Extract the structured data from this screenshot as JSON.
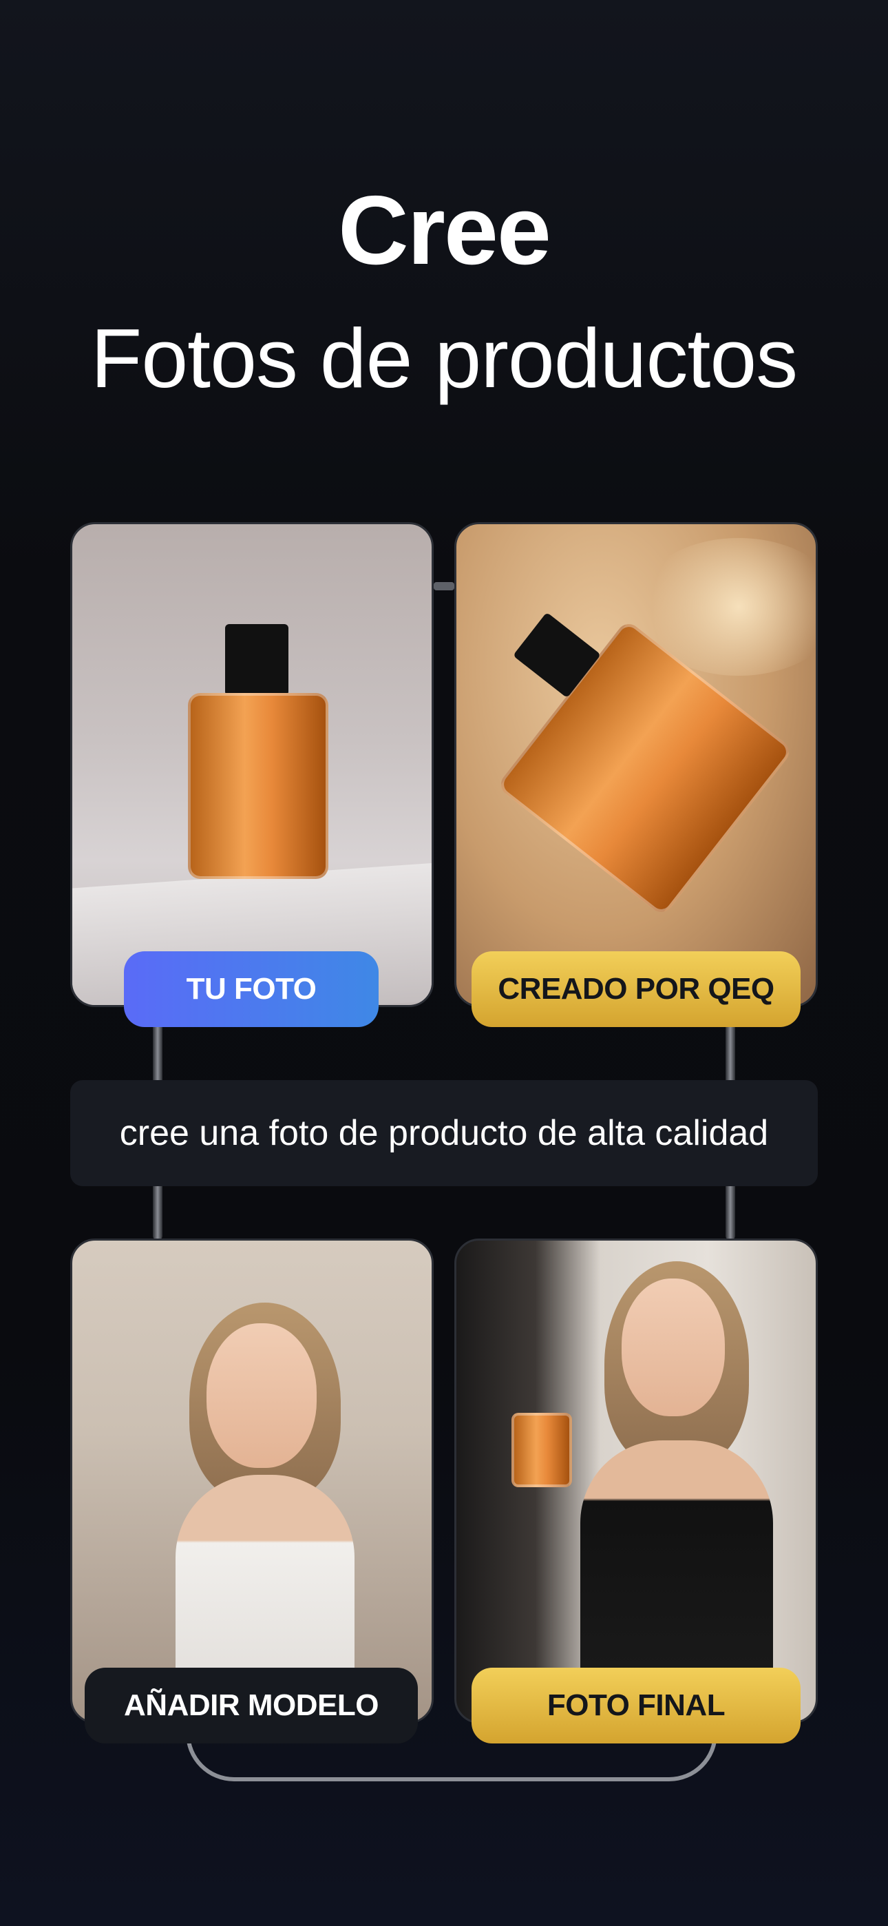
{
  "header": {
    "title": "Cree",
    "subtitle": "Fotos de productos"
  },
  "cards": {
    "your_photo_label": "TU FOTO",
    "created_label": "CREADO POR QEQ",
    "add_model_label": "AÑADIR MODELO",
    "final_photo_label": "FOTO FINAL"
  },
  "prompt": {
    "text": "cree una foto de producto de alta calidad"
  },
  "colors": {
    "accent_blue": "#4f7af0",
    "accent_gold": "#e2b842",
    "background": "#0b0c10"
  }
}
